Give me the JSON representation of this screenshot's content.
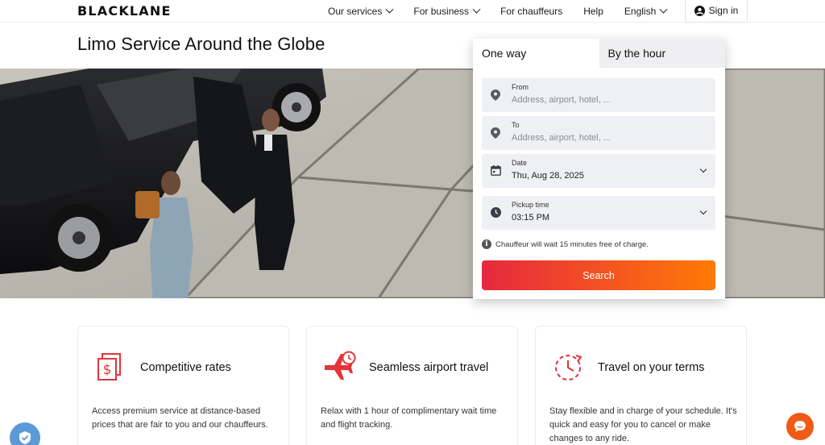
{
  "header": {
    "logo": "BLACKLANE",
    "nav": [
      {
        "label": "Our services",
        "dropdown": true
      },
      {
        "label": "For business",
        "dropdown": true
      },
      {
        "label": "For chauffeurs",
        "dropdown": false
      },
      {
        "label": "Help",
        "dropdown": false
      },
      {
        "label": "English",
        "dropdown": true
      }
    ],
    "sign_in": "Sign in"
  },
  "hero": {
    "title": "Limo Service Around the Globe"
  },
  "booking": {
    "tabs": [
      {
        "label": "One way",
        "active": true
      },
      {
        "label": "By the hour",
        "active": false
      }
    ],
    "from": {
      "label": "From",
      "placeholder": "Address, airport, hotel, ...",
      "icon": "location-pin-icon"
    },
    "to": {
      "label": "To",
      "placeholder": "Address, airport, hotel, ...",
      "icon": "location-pin-icon"
    },
    "date": {
      "label": "Date",
      "value": "Thu, Aug 28, 2025",
      "icon": "calendar-icon"
    },
    "pickup_time": {
      "label": "Pickup time",
      "value": "03:15 PM",
      "icon": "clock-icon"
    },
    "note": "Chauffeur will wait 15 minutes free of charge.",
    "search_label": "Search"
  },
  "features": [
    {
      "title": "Competitive rates",
      "icon": "dollar-bills-icon",
      "description": "Access premium service at distance-based prices that are fair to you and our chauffeurs."
    },
    {
      "title": "Seamless airport travel",
      "icon": "airplane-clock-icon",
      "description": "Relax with 1 hour of complimentary wait time and flight tracking."
    },
    {
      "title": "Travel on your terms",
      "icon": "flexible-schedule-icon",
      "description": "Stay flexible and in charge of your schedule. It's quick and easy for you to cancel or make changes to any ride."
    }
  ],
  "colors": {
    "accent_start": "#e6283f",
    "accent_end": "#ff7a05",
    "icon_red": "#e3343b",
    "chat": "#f05a14",
    "shield": "#5b9ad6"
  }
}
